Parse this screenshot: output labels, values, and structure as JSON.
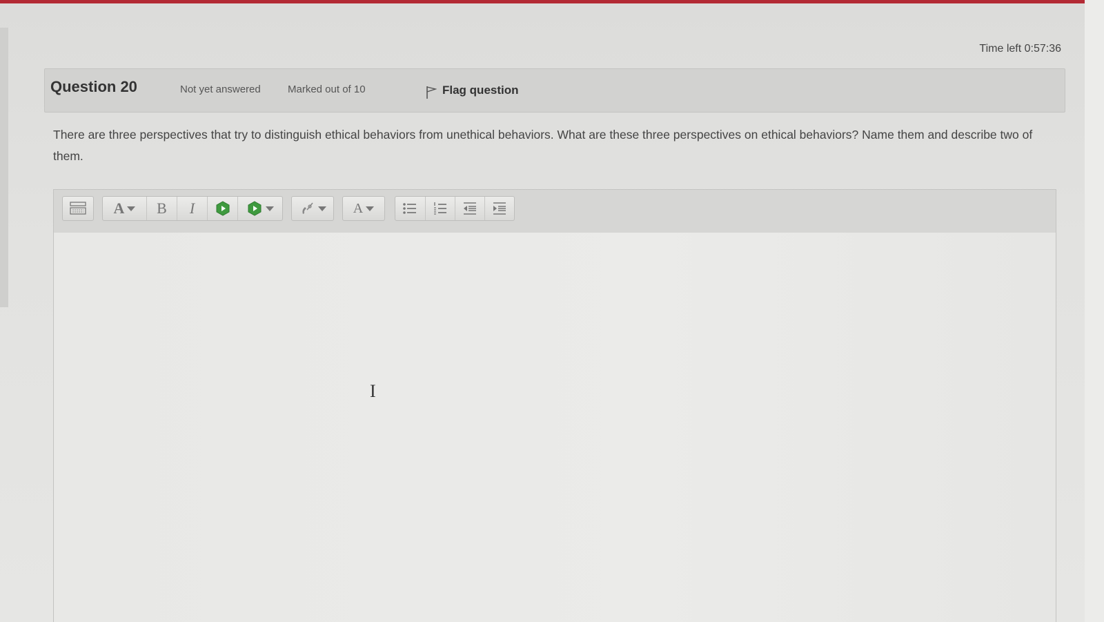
{
  "header": {
    "timer_label": "Time left 0:57:36"
  },
  "question": {
    "number_label": "Question 20",
    "status": "Not yet answered",
    "marks": "Marked out of 10",
    "flag_label": "Flag question",
    "text": "There are three perspectives that try to distinguish ethical behaviors from unethical behaviors. What are these three perspectives on ethical behaviors? Name them and describe two of them."
  },
  "editor": {
    "toolbar": {
      "font_family_label": "A",
      "bold_label": "B",
      "italic_label": "I",
      "font_color_label": "A"
    },
    "content": ""
  },
  "colors": {
    "accent_bar": "#b32a34",
    "media_green": "#3f9a3f"
  }
}
